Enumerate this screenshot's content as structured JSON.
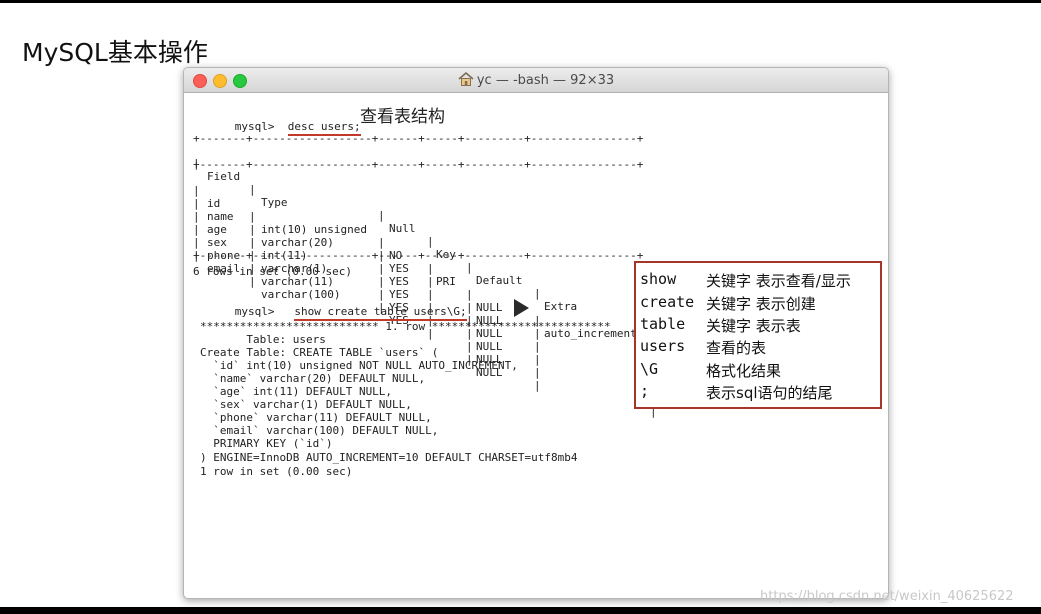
{
  "slide": {
    "title": "MySQL基本操作"
  },
  "window": {
    "title": "yc — -bash — 92×33"
  },
  "cmd1": {
    "prompt": "mysql>",
    "command": "desc users;",
    "annotation": "查看表结构"
  },
  "table": {
    "border": "+-------+------------------+------+-----+---------+----------------+",
    "headers": [
      "Field",
      "Type",
      "Null",
      "Key",
      "Default",
      "Extra"
    ],
    "rows": [
      [
        "id",
        "int(10) unsigned",
        "NO",
        "PRI",
        "NULL",
        "auto_increment"
      ],
      [
        "name",
        "varchar(20)",
        "YES",
        "",
        "NULL",
        ""
      ],
      [
        "age",
        "int(11)",
        "YES",
        "",
        "NULL",
        ""
      ],
      [
        "sex",
        "varchar(1)",
        "YES",
        "",
        "NULL",
        ""
      ],
      [
        "phone",
        "varchar(11)",
        "YES",
        "",
        "NULL",
        ""
      ],
      [
        "email",
        "varchar(100)",
        "YES",
        "",
        "NULL",
        ""
      ]
    ],
    "summary": "6 rows in set (0.00 sec)"
  },
  "cmd2": {
    "prompt": "mysql>",
    "command": "show create table users\\G;",
    "output": [
      "*************************** 1. row ***************************",
      "       Table: users",
      "Create Table: CREATE TABLE `users` (",
      "  `id` int(10) unsigned NOT NULL AUTO_INCREMENT,",
      "  `name` varchar(20) DEFAULT NULL,",
      "  `age` int(11) DEFAULT NULL,",
      "  `sex` varchar(1) DEFAULT NULL,",
      "  `phone` varchar(11) DEFAULT NULL,",
      "  `email` varchar(100) DEFAULT NULL,",
      "  PRIMARY KEY (`id`)",
      ") ENGINE=InnoDB AUTO_INCREMENT=10 DEFAULT CHARSET=utf8mb4",
      "1 row in set (0.00 sec)"
    ]
  },
  "legend": {
    "items": [
      {
        "key": "show",
        "desc": "关键字  表示查看/显示"
      },
      {
        "key": "create",
        "desc": "关键字  表示创建"
      },
      {
        "key": "table",
        "desc": "关键字  表示表"
      },
      {
        "key": "users",
        "desc": "查看的表"
      },
      {
        "key": "\\G",
        "desc": "格式化结果"
      },
      {
        "key": ";",
        "desc": "表示sql语句的结尾"
      }
    ]
  },
  "watermark": "https://blog.csdn.net/weixin_40625622",
  "colors": {
    "underline": "#c0392b",
    "legend_border": "#a33529"
  },
  "icons": [
    "home-icon",
    "play-icon"
  ]
}
